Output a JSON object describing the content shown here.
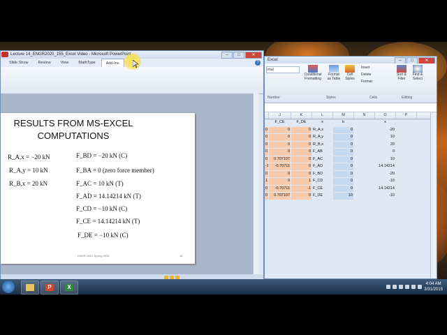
{
  "powerpoint": {
    "title": "Lecture 14_ENGR2020_155_Excel Video - Microsoft PowerPoint",
    "tabs": [
      "Slide Show",
      "Review",
      "View",
      "MathType",
      "Add-Ins"
    ],
    "active_tab": "Add-Ins",
    "slide": {
      "title_line1": "RESULTS FROM MS-EXCEL",
      "title_line2": "COMPUTATIONS",
      "left_equations": [
        "R_A,x = −20 kN",
        "R_A,y = 10 kN",
        "R_B,x = 20 kN"
      ],
      "right_equations": [
        "F_BD = −20 kN (C)",
        "F_BA = 0 (zero force member)",
        "F_AC = 10 kN (T)",
        "F_AD = 14.14214 kN (T)",
        "F_CD = −10 kN (C)",
        "F_CE = 14.14214 kN (T)",
        "F_DE = −10 kN (C)"
      ],
      "footer": "ENGR 2020, Spring 2015",
      "page_number": "18"
    }
  },
  "excel": {
    "title": "Excel",
    "ribbon": {
      "font_box": "rmal",
      "conditional": "Conditional Formatting",
      "format_table": "Format as Table",
      "cell_styles": "Cell Styles",
      "insert": "Insert",
      "delete": "Delete",
      "format": "Format",
      "sort": "Sort & Filter",
      "find": "Find & Select",
      "groups": [
        "Number",
        "Styles",
        "Cells",
        "Editing"
      ]
    },
    "columns": [
      "J",
      "K",
      "L",
      "M",
      "N",
      "O",
      "P"
    ],
    "rows": [
      [
        "F_CE",
        "F_DE",
        "x",
        "b",
        "",
        "x",
        ""
      ],
      [
        "0",
        "0",
        "R_A,x",
        "0",
        "",
        "-20",
        ""
      ],
      [
        "0",
        "0",
        "R_A,y",
        "0",
        "",
        "10",
        ""
      ],
      [
        "0",
        "0",
        "R_B,x",
        "0",
        "",
        "20",
        ""
      ],
      [
        "0",
        "0",
        "F_AB",
        "0",
        "",
        "0",
        ""
      ],
      [
        "0.707107",
        "0",
        "F_AC",
        "0",
        "",
        "10",
        ""
      ],
      [
        "-0.70711",
        "0",
        "F_AD",
        "0",
        "",
        "14.14214",
        ""
      ],
      [
        "0",
        "0",
        "F_BD",
        "0",
        "",
        "-20",
        ""
      ],
      [
        "0",
        "1",
        "F_CD",
        "0",
        "",
        "-10",
        ""
      ],
      [
        "-0.70711",
        "-1",
        "F_CE",
        "0",
        "",
        "14.14214",
        ""
      ],
      [
        "0.707107",
        "0",
        "F_DE",
        "10",
        "",
        "-10",
        ""
      ]
    ],
    "left_partial": [
      "",
      "0",
      "0",
      "0",
      "0",
      "0",
      "-1",
      "0",
      "1",
      "0",
      "0"
    ]
  },
  "taskbar": {
    "time": "4:04 AM",
    "date": "3/31/2015",
    "apps": [
      "folder",
      "P",
      "X"
    ]
  }
}
